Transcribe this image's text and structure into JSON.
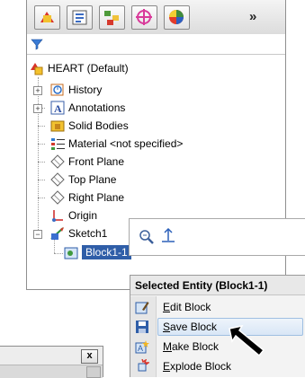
{
  "toolbar": {
    "buttons": [
      {
        "icon": "feature-manager-icon"
      },
      {
        "icon": "property-manager-icon"
      },
      {
        "icon": "configuration-manager-icon"
      },
      {
        "icon": "dimxpert-icon"
      },
      {
        "icon": "display-manager-icon"
      }
    ],
    "more_label": "»"
  },
  "filter": {
    "icon": "filter-icon"
  },
  "tree": {
    "root": "HEART  (Default)",
    "items": [
      {
        "label": "History",
        "icon": "history-icon"
      },
      {
        "label": "Annotations",
        "icon": "annotations-icon"
      },
      {
        "label": "Solid Bodies",
        "icon": "solid-bodies-icon"
      },
      {
        "label": "Material <not specified>",
        "icon": "material-icon"
      },
      {
        "label": "Front Plane",
        "icon": "plane-icon"
      },
      {
        "label": "Top Plane",
        "icon": "plane-icon"
      },
      {
        "label": "Right Plane",
        "icon": "plane-icon"
      },
      {
        "label": "Origin",
        "icon": "origin-icon"
      },
      {
        "label": "Sketch1",
        "icon": "sketch-icon"
      },
      {
        "label": "Block1-1",
        "icon": "block-icon"
      }
    ]
  },
  "context_toolbar": {
    "tools": [
      "zoom-to-selection-icon",
      "normal-to-icon"
    ]
  },
  "context_menu": {
    "title": "Selected Entity (Block1-1)",
    "items": [
      {
        "label": "Edit Block",
        "accel": "E",
        "rest": "dit Block",
        "icon": "edit-block-icon"
      },
      {
        "label": "Save Block",
        "accel": "S",
        "rest": "ave Block",
        "icon": "save-block-icon"
      },
      {
        "label": "Make Block",
        "accel": "M",
        "rest": "ake Block",
        "icon": "make-block-icon"
      },
      {
        "label": "Explode Block",
        "accel": "E",
        "rest": "xplode Block",
        "icon": "explode-block-icon"
      }
    ]
  },
  "dialog": {
    "close_label": "x"
  },
  "colors": {
    "selection": "#2f5ea8",
    "menu_hover": "#d8e6f6"
  }
}
